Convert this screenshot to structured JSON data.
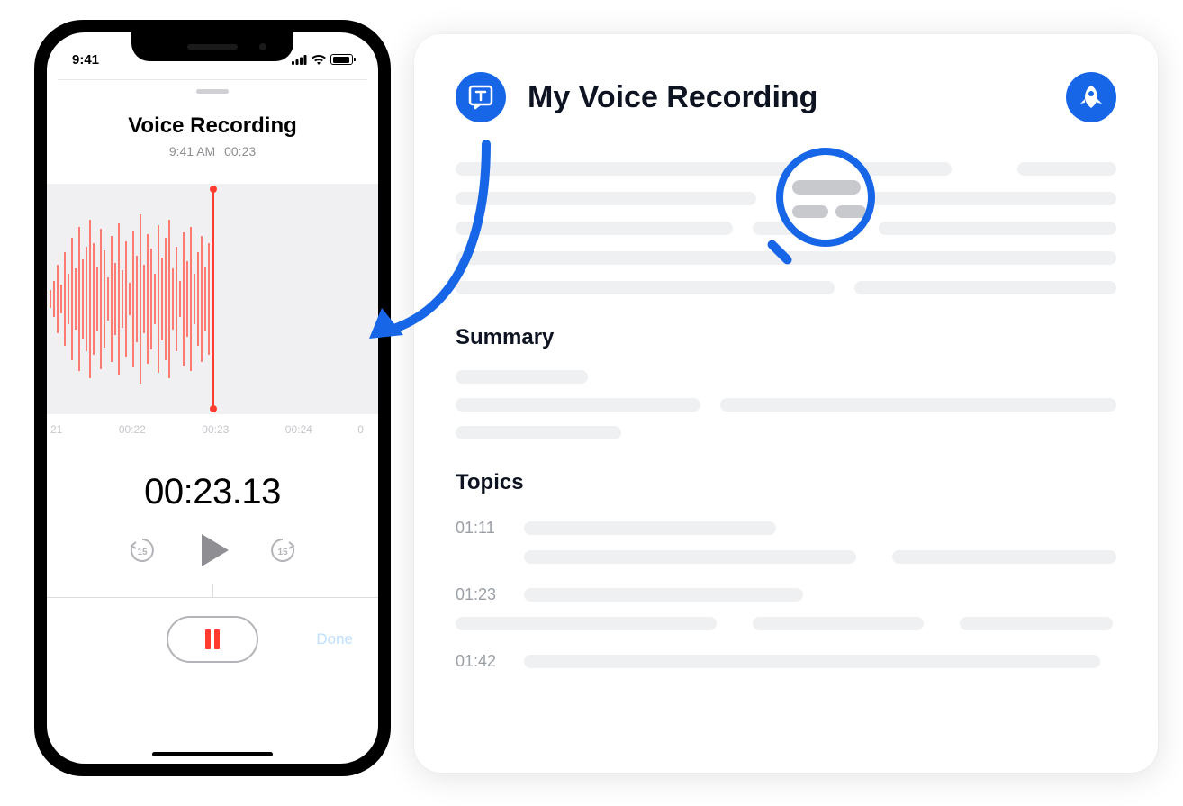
{
  "phone": {
    "status_time": "9:41",
    "title": "Voice Recording",
    "sub_time": "9:41 AM",
    "sub_duration": "00:23",
    "ruler": [
      "21",
      "00:22",
      "00:23",
      "00:24",
      "0"
    ],
    "big_timer": "00:23.13",
    "skip_back_label": "15",
    "skip_fwd_label": "15",
    "done_label": "Done"
  },
  "card": {
    "title": "My Voice Recording",
    "summary_heading": "Summary",
    "topics_heading": "Topics",
    "topics": [
      {
        "time": "01:11"
      },
      {
        "time": "01:23"
      },
      {
        "time": "01:42"
      }
    ]
  }
}
